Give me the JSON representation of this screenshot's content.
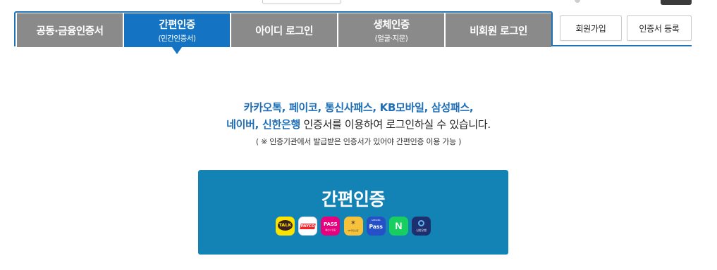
{
  "tabs": [
    {
      "label": "공동·금융인증서",
      "sub": ""
    },
    {
      "label": "간편인증",
      "sub": "(민간인증서)"
    },
    {
      "label": "아이디 로그인",
      "sub": ""
    },
    {
      "label": "생체인증",
      "sub": "(얼굴·지문)"
    },
    {
      "label": "비회원 로그인",
      "sub": ""
    }
  ],
  "active_tab": "간편인증",
  "buttons": {
    "signup": "회원가입",
    "cert_register": "인증서 등록"
  },
  "description": {
    "line1": "카카오톡, 페이코, 통신사패스, KB모바일, 삼성패스,",
    "line2_highlight": "네이버, 신한은행",
    "line2_rest": " 인증서를 이용하여 로그인하실 수 있습니다.",
    "note": "( ※ 인증기관에서 발급받은 인증서가 있어야 간편인증 이용 가능 )"
  },
  "simple_auth": {
    "title": "간편인증",
    "providers": [
      {
        "icon": "kakao-talk-icon",
        "text": "TALK"
      },
      {
        "icon": "payco-icon",
        "text": "PAYCO"
      },
      {
        "icon": "pass-icon",
        "text": "PASS",
        "sub": "통신사 인증"
      },
      {
        "icon": "kb-icon",
        "sub": "KB국민인증"
      },
      {
        "icon": "samsung-pass-icon",
        "text": "Pass",
        "sub": "SAMSUNG"
      },
      {
        "icon": "naver-icon",
        "text": "N"
      },
      {
        "icon": "shinhan-icon",
        "sub": "신한은행"
      }
    ]
  },
  "colors": {
    "accent": "#1473c2",
    "tab_inactive": "#8a8a8a",
    "button_bg": "#1383b5",
    "highlight_text": "#1f6fb8"
  }
}
